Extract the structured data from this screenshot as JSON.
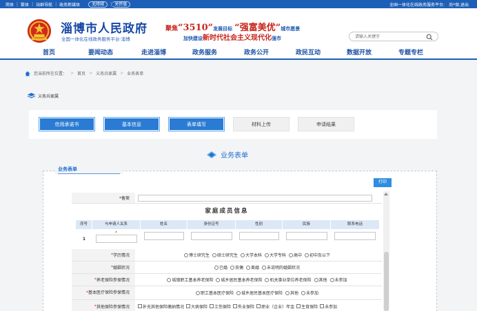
{
  "topbar": {
    "left": [
      "简体",
      "繁体",
      "站群导航",
      "政务新媒体"
    ],
    "pill1": "无障碍",
    "pill2": "关怀版",
    "portal": "全国一体化在线政务服务平台",
    "user": "尚*保,退出"
  },
  "header": {
    "title": "淄博市人民政府",
    "subtitle": "全国一体化在线政务服务平台·淄博",
    "slogan1_a": "聚焦",
    "slogan1_b": "“3510”",
    "slogan1_c": "发展目标",
    "slogan1_d": "“强富美优”",
    "slogan1_e": "城市愿景",
    "slogan2_a": "加快建设",
    "slogan2_b": "新时代社会主义现代化",
    "slogan2_c": "强市",
    "search_placeholder": "请输入关键字"
  },
  "nav": [
    "首页",
    "要闻动态",
    "走进淄博",
    "政务服务",
    "政务公开",
    "政民互动",
    "数据开放",
    "专题专栏"
  ],
  "breadcrumb": {
    "prefix": "您当前所在位置：",
    "items": [
      "首页",
      "义务兵家属",
      "业务表单"
    ]
  },
  "section_tag": "义务兵家属",
  "steps": [
    {
      "label": "信用承诺书",
      "done": true
    },
    {
      "label": "基本信息",
      "done": true
    },
    {
      "label": "表单填写",
      "done": true
    },
    {
      "label": "材料上传",
      "done": false
    },
    {
      "label": "申请结果",
      "done": false
    }
  ],
  "form_title": "业务表单",
  "panel_label": "业务表单",
  "print_label": "打印",
  "form": {
    "notes_label": "*备案",
    "family_title": "家庭成员信息",
    "table_headers": [
      "序号",
      "与申请人关系",
      "姓名",
      "身份证号",
      "性别",
      "民族",
      "联系电话"
    ],
    "row_index": "1",
    "rows": [
      {
        "label": "*学历情况",
        "type": "radio",
        "options": [
          "博士研究生",
          "硕士研究生",
          "大学本科",
          "大学专科",
          "高中",
          "初中及以下"
        ]
      },
      {
        "label": "*婚姻状况",
        "type": "radio",
        "options": [
          "已婚",
          "丧偶",
          "离婚",
          "未说明的婚姻状况"
        ]
      },
      {
        "label": "*养老保险参保情况",
        "type": "radio",
        "options": [
          "城镇职工基本养老保险",
          "城乡居民基本养老保险",
          "机关事业单位养老保险",
          "其他",
          "未参加"
        ]
      },
      {
        "label": "*基本医疗保险参保情况",
        "type": "radio",
        "options": [
          "职工基本医疗保险",
          "城乡居民基本医疗保险",
          "其他",
          "未参加"
        ]
      },
      {
        "label": "*其他保险参保情况",
        "type": "check",
        "options": [
          "补充其他保险缴纳情况",
          "大病保险",
          "工伤保险",
          "失业保险",
          "职业（企业）年金",
          "生育保险",
          "未参加"
        ]
      }
    ]
  },
  "colors": {
    "brand": "#1d5fb6",
    "accent_red": "#c8241b",
    "step_active": "#2a7bd3",
    "link_blue": "#1e6ed0"
  }
}
